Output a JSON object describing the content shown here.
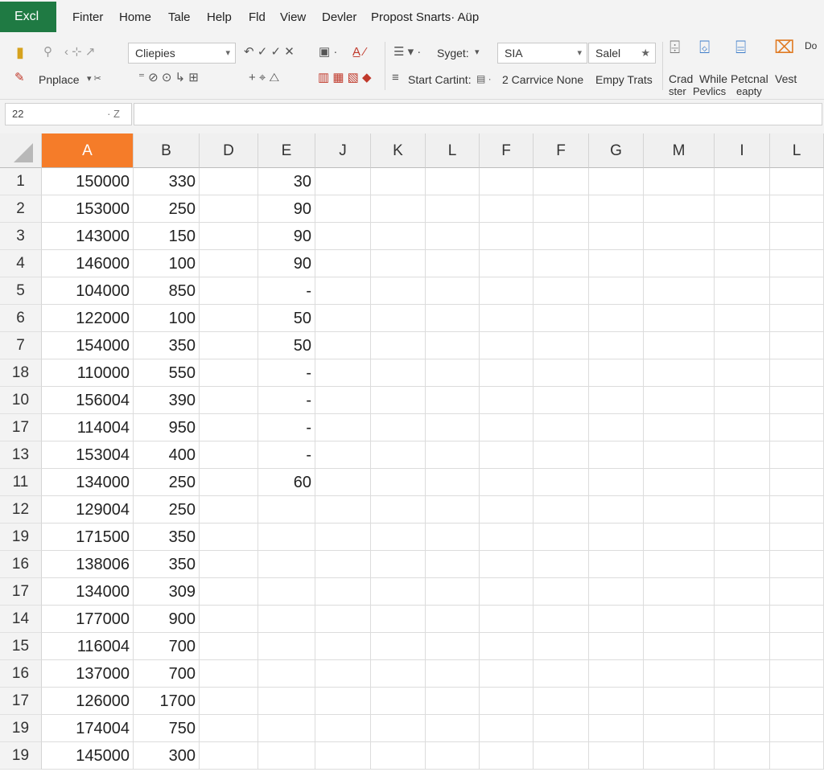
{
  "app": {
    "title": "Excl"
  },
  "menu": [
    "Finter",
    "Home",
    "Tale",
    "Help",
    "Fld",
    "View",
    "Devler",
    "Propost Snarts· Aüp"
  ],
  "ribbon": {
    "row1": {
      "font_box": "Cliepies",
      "style_label": "Syget:",
      "style_box": "SIA",
      "style_box2": "Salel"
    },
    "row2": {
      "replace": "Pnplace",
      "start": "Start Cartint:",
      "carrvice": "2 Carrvice None",
      "empy": "Empy Trats"
    },
    "groups": [
      {
        "line1": "Crad",
        "line2": "ster"
      },
      {
        "line1": "While",
        "line2": "Pevlics"
      },
      {
        "line1": "Petcnal",
        "line2": "eapty"
      },
      {
        "line1": "Vest",
        "line2": ""
      }
    ],
    "far_right": "Do",
    "accent_colors": {
      "brand": "#1f7a43",
      "selected_col": "#f57c29"
    }
  },
  "formula_bar": {
    "name_box": "22",
    "name_box_arrow": "· Z"
  },
  "grid": {
    "columns": [
      "A",
      "B",
      "D",
      "E",
      "J",
      "K",
      "L",
      "F",
      "F",
      "G",
      "M",
      "I",
      "L"
    ],
    "selected_column": "A",
    "rows": [
      {
        "h": "1",
        "a": "150000",
        "b": "330",
        "e": "30"
      },
      {
        "h": "2",
        "a": "153000",
        "b": "250",
        "e": "90"
      },
      {
        "h": "3",
        "a": "143000",
        "b": "150",
        "e": "90"
      },
      {
        "h": "4",
        "a": "146000",
        "b": "100",
        "e": "90"
      },
      {
        "h": "5",
        "a": "104000",
        "b": "850",
        "e": "-"
      },
      {
        "h": "6",
        "a": "122000",
        "b": "100",
        "e": "50"
      },
      {
        "h": "7",
        "a": "154000",
        "b": "350",
        "e": "50"
      },
      {
        "h": "18",
        "a": "110000",
        "b": "550",
        "e": "-"
      },
      {
        "h": "10",
        "a": "156004",
        "b": "390",
        "e": "-"
      },
      {
        "h": "17",
        "a": "114004",
        "b": "950",
        "e": "-"
      },
      {
        "h": "13",
        "a": "153004",
        "b": "400",
        "e": "-"
      },
      {
        "h": "11",
        "a": "134000",
        "b": "250",
        "e": "60"
      },
      {
        "h": "12",
        "a": "129004",
        "b": "250",
        "e": ""
      },
      {
        "h": "19",
        "a": "171500",
        "b": "350",
        "e": ""
      },
      {
        "h": "16",
        "a": "138006",
        "b": "350",
        "e": ""
      },
      {
        "h": "17",
        "a": "134000",
        "b": "309",
        "e": ""
      },
      {
        "h": "14",
        "a": "177000",
        "b": "900",
        "e": ""
      },
      {
        "h": "15",
        "a": "116004",
        "b": "700",
        "e": ""
      },
      {
        "h": "16",
        "a": "137000",
        "b": "700",
        "e": ""
      },
      {
        "h": "17",
        "a": "126000",
        "b": "1700",
        "e": ""
      },
      {
        "h": "19",
        "a": "174004",
        "b": "750",
        "e": ""
      },
      {
        "h": "19",
        "a": "145000",
        "b": "300",
        "e": ""
      }
    ]
  }
}
